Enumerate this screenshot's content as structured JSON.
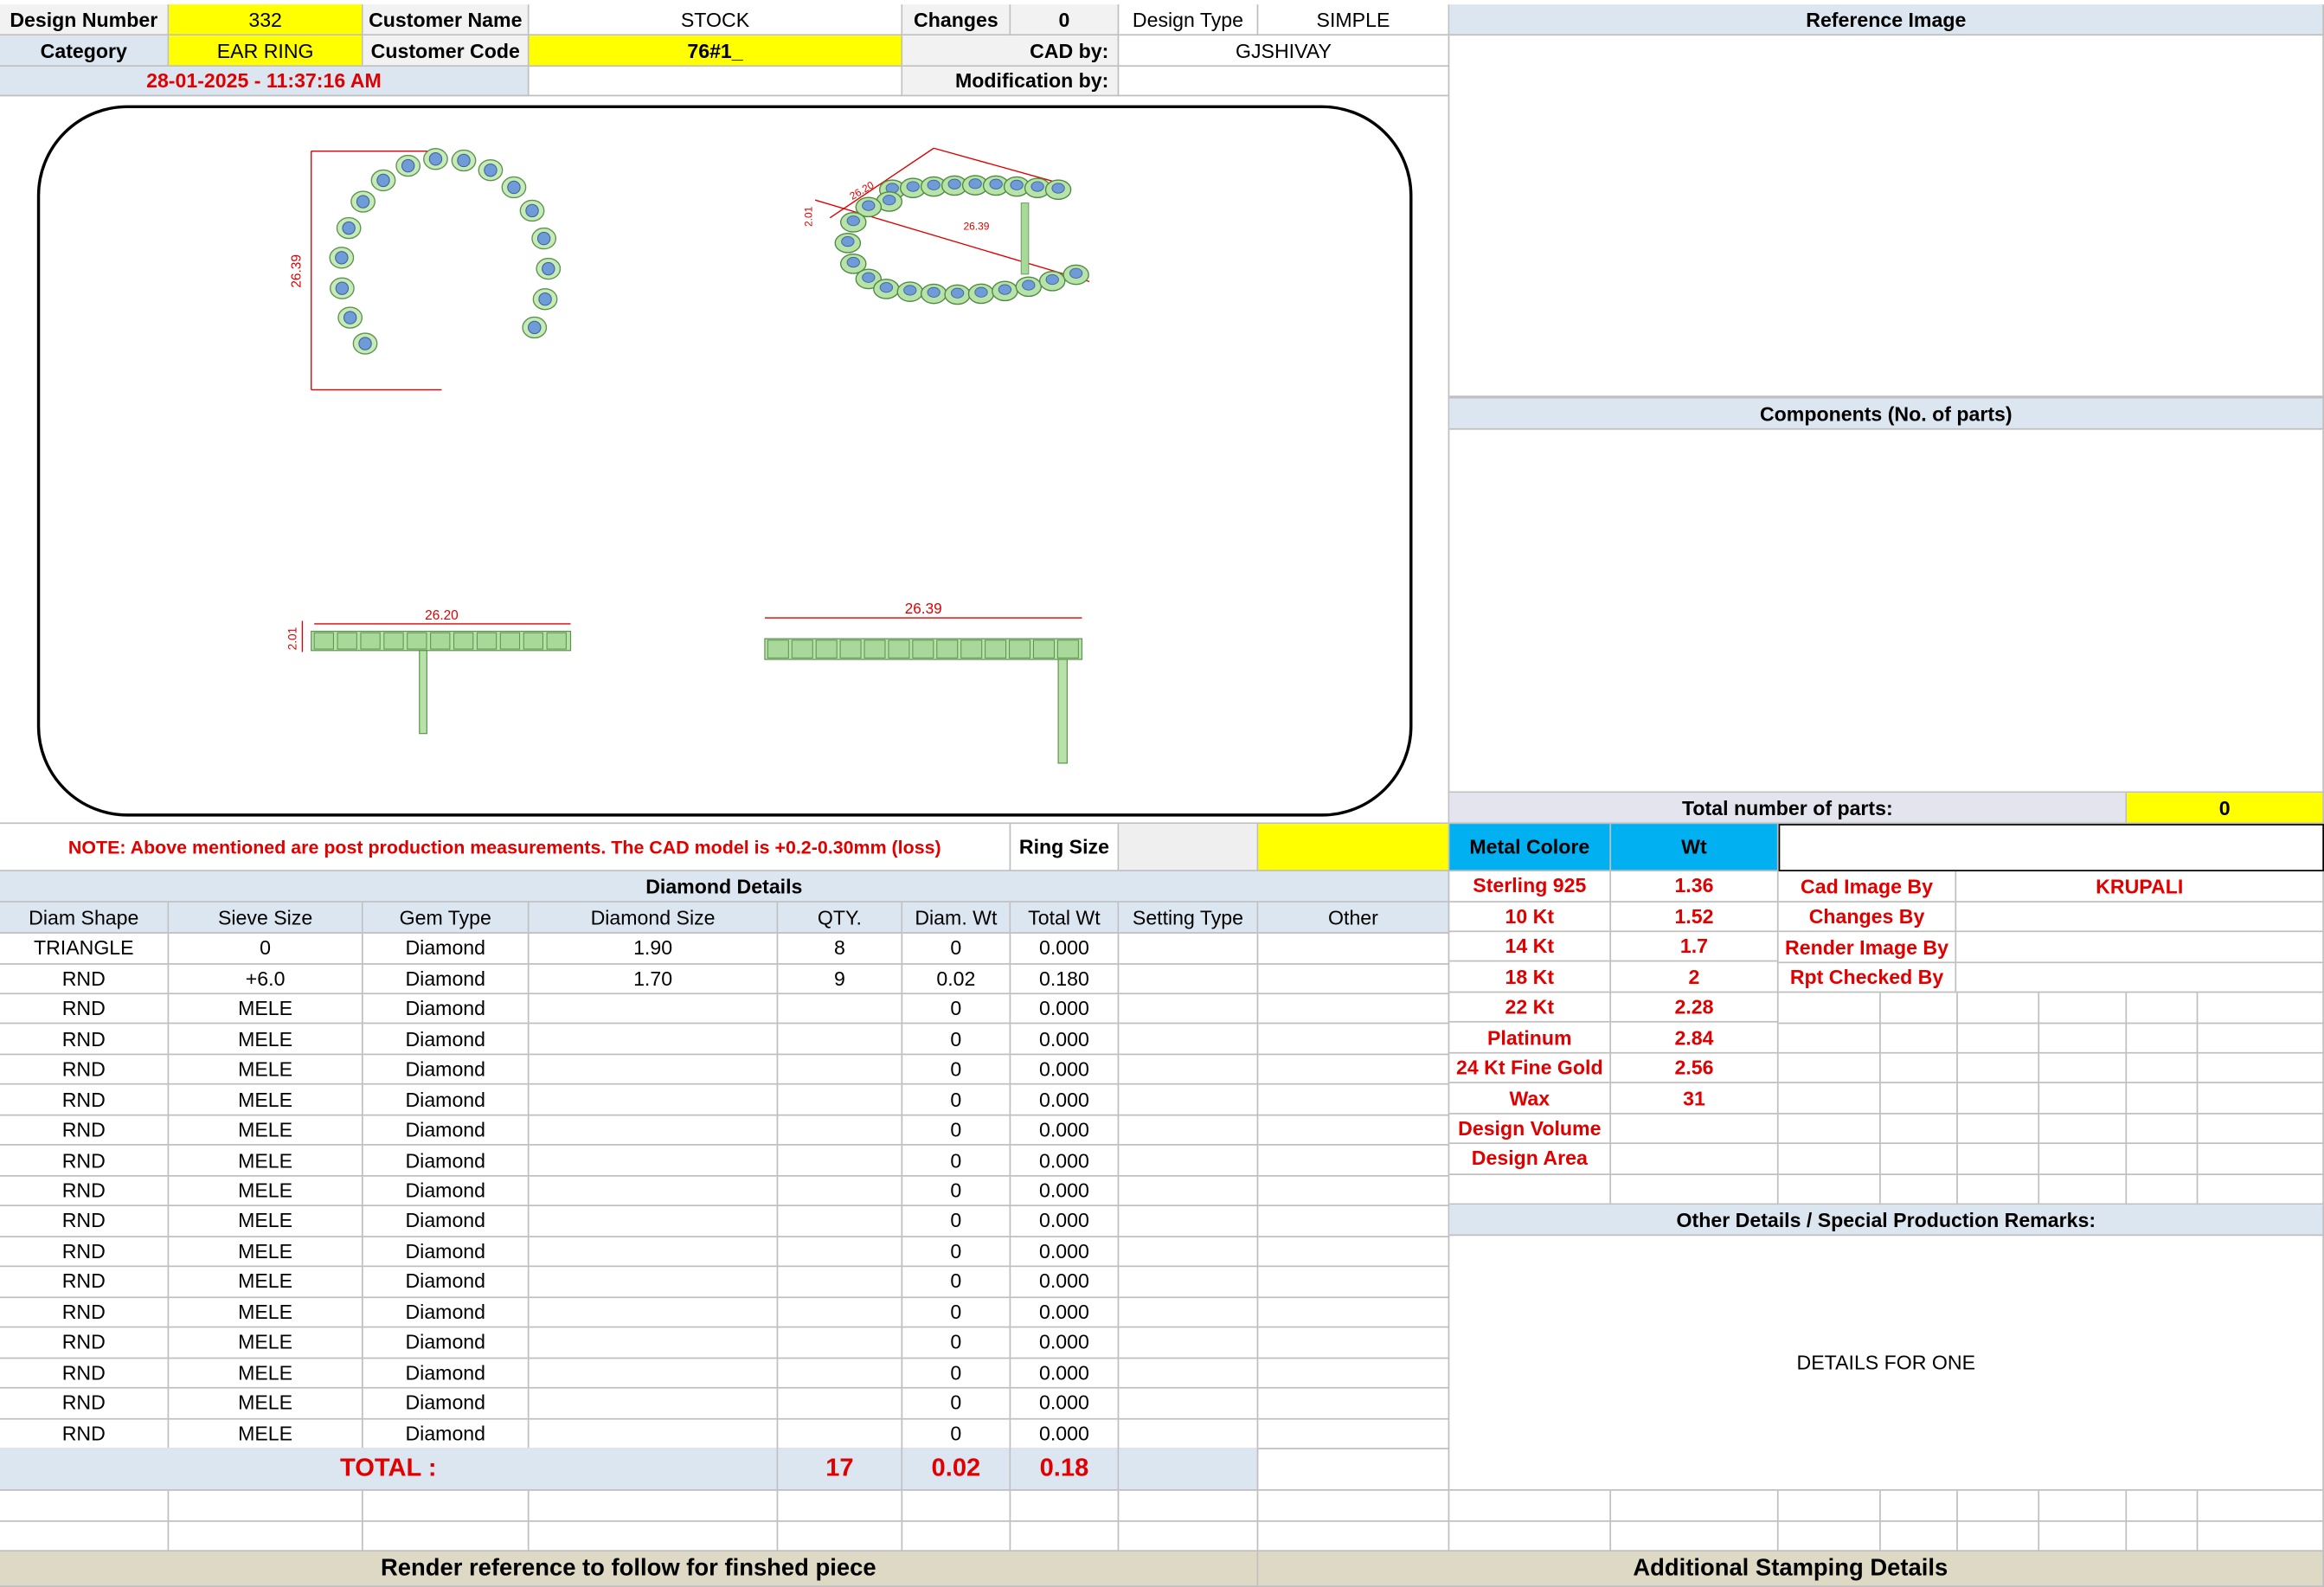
{
  "header": {
    "design_number_label": "Design Number",
    "design_number": "332",
    "customer_name_label": "Customer Name",
    "customer_name": "STOCK",
    "changes_label": "Changes",
    "changes": "0",
    "design_type_label": "Design Type",
    "design_type": "SIMPLE",
    "category_label": "Category",
    "category": "EAR RING",
    "customer_code_label": "Customer Code",
    "customer_code": "76#1_",
    "cad_by_label": "CAD by:",
    "cad_by": "GJSHIVAY",
    "timestamp": "28-01-2025 - 11:37:16 AM",
    "modification_label": "Modification by:",
    "modification_by": ""
  },
  "drawing": {
    "dim_top_height": "26.39",
    "dim_side_a": "26.20",
    "dim_side_thickness": "2.01",
    "dim_side_b": "26.39",
    "dim_persp_1": "26.20",
    "dim_persp_2": "26.39",
    "dim_persp_3": "2.01"
  },
  "right_panel": {
    "reference_image_label": "Reference Image",
    "components_label": "Components (No. of parts)",
    "total_parts_label": "Total number of parts:",
    "total_parts": "0"
  },
  "note": {
    "text": "NOTE: Above mentioned are post production measurements. The CAD model is +0.2-0.30mm (loss)",
    "ring_size_label": "Ring Size",
    "ring_size": ""
  },
  "diamond": {
    "title": "Diamond Details",
    "columns": [
      "Diam Shape",
      "Sieve Size",
      "Gem Type",
      "Diamond Size",
      "QTY.",
      "Diam. Wt",
      "Total Wt",
      "Setting Type",
      "Other"
    ],
    "rows": [
      [
        "TRIANGLE",
        "0",
        "Diamond",
        "1.90",
        "8",
        "0",
        "0.000",
        "",
        ""
      ],
      [
        "RND",
        "+6.0",
        "Diamond",
        "1.70",
        "9",
        "0.02",
        "0.180",
        "",
        ""
      ],
      [
        "RND",
        "MELE",
        "Diamond",
        "",
        "",
        "0",
        "0.000",
        "",
        ""
      ],
      [
        "RND",
        "MELE",
        "Diamond",
        "",
        "",
        "0",
        "0.000",
        "",
        ""
      ],
      [
        "RND",
        "MELE",
        "Diamond",
        "",
        "",
        "0",
        "0.000",
        "",
        ""
      ],
      [
        "RND",
        "MELE",
        "Diamond",
        "",
        "",
        "0",
        "0.000",
        "",
        ""
      ],
      [
        "RND",
        "MELE",
        "Diamond",
        "",
        "",
        "0",
        "0.000",
        "",
        ""
      ],
      [
        "RND",
        "MELE",
        "Diamond",
        "",
        "",
        "0",
        "0.000",
        "",
        ""
      ],
      [
        "RND",
        "MELE",
        "Diamond",
        "",
        "",
        "0",
        "0.000",
        "",
        ""
      ],
      [
        "RND",
        "MELE",
        "Diamond",
        "",
        "",
        "0",
        "0.000",
        "",
        ""
      ],
      [
        "RND",
        "MELE",
        "Diamond",
        "",
        "",
        "0",
        "0.000",
        "",
        ""
      ],
      [
        "RND",
        "MELE",
        "Diamond",
        "",
        "",
        "0",
        "0.000",
        "",
        ""
      ],
      [
        "RND",
        "MELE",
        "Diamond",
        "",
        "",
        "0",
        "0.000",
        "",
        ""
      ],
      [
        "RND",
        "MELE",
        "Diamond",
        "",
        "",
        "0",
        "0.000",
        "",
        ""
      ],
      [
        "RND",
        "MELE",
        "Diamond",
        "",
        "",
        "0",
        "0.000",
        "",
        ""
      ],
      [
        "RND",
        "MELE",
        "Diamond",
        "",
        "",
        "0",
        "0.000",
        "",
        ""
      ],
      [
        "RND",
        "MELE",
        "Diamond",
        "",
        "",
        "0",
        "0.000",
        "",
        ""
      ]
    ],
    "total_label": "TOTAL :",
    "total_qty": "17",
    "total_diam_wt": "0.02",
    "total_wt": "0.18"
  },
  "metal": {
    "color_label": "Metal Colore",
    "wt_label": "Wt",
    "rows": [
      {
        "name": "Sterling 925",
        "wt": "1.36"
      },
      {
        "name": "10 Kt",
        "wt": "1.52"
      },
      {
        "name": "14 Kt",
        "wt": "1.7"
      },
      {
        "name": "18 Kt",
        "wt": "2"
      },
      {
        "name": "22 Kt",
        "wt": "2.28"
      },
      {
        "name": "Platinum",
        "wt": "2.84"
      },
      {
        "name": "24 Kt Fine Gold",
        "wt": "2.56"
      },
      {
        "name": "Wax",
        "wt": "31"
      },
      {
        "name": "Design Volume",
        "wt": ""
      },
      {
        "name": "Design Area",
        "wt": ""
      }
    ]
  },
  "credits": {
    "cad_image_label": "Cad Image By",
    "cad_image_by": "KRUPALI",
    "changes_by_label": "Changes By",
    "render_image_label": "Render Image By",
    "rpt_checked_label": "Rpt Checked By"
  },
  "remarks": {
    "title": "Other Details / Special Production Remarks:",
    "text": "DETAILS FOR ONE"
  },
  "footer": {
    "render_reference": "Render reference to follow for finshed piece",
    "stamping": "Additional Stamping Details"
  },
  "colors": {
    "yellow": "#ffff00",
    "header_blue": "#dce6f1",
    "cyan": "#00b0f0",
    "red": "#e00000",
    "footer_tan": "#ddd9c4",
    "model_green": "#b7e3a8",
    "stone_blue": "#6f9bd8"
  }
}
